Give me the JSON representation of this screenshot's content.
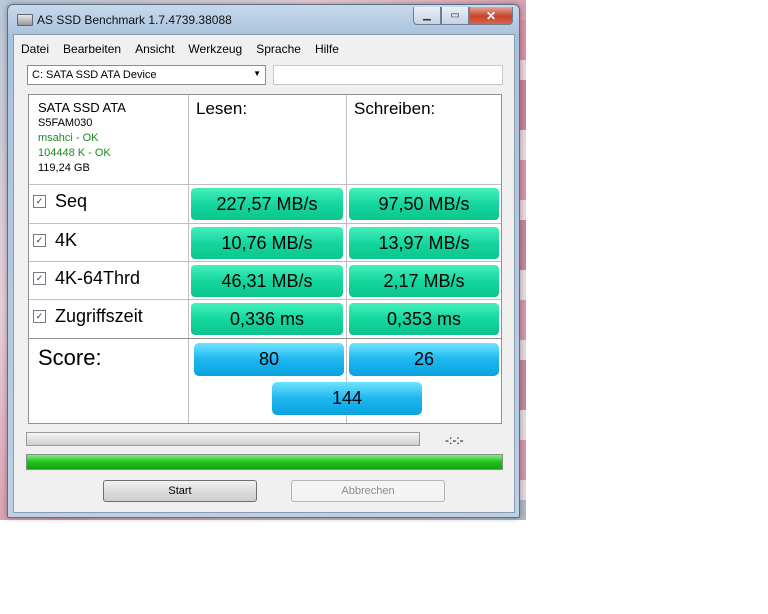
{
  "window": {
    "title": "AS SSD Benchmark 1.7.4739.38088"
  },
  "menu": [
    "Datei",
    "Bearbeiten",
    "Ansicht",
    "Werkzeug",
    "Sprache",
    "Hilfe"
  ],
  "drive": {
    "selected": "C: SATA SSD ATA Device"
  },
  "info": {
    "model": "SATA SSD ATA",
    "firmware": "S5FAM030",
    "driver_status": "msahci - OK",
    "alignment_status": "104448 K - OK",
    "capacity": "119,24 GB"
  },
  "columns": {
    "read": "Lesen:",
    "write": "Schreiben:"
  },
  "rows": [
    {
      "label": "Seq",
      "checked": true,
      "read": "227,57 MB/s",
      "write": "97,50 MB/s"
    },
    {
      "label": "4K",
      "checked": true,
      "read": "10,76 MB/s",
      "write": "13,97 MB/s"
    },
    {
      "label": "4K-64Thrd",
      "checked": true,
      "read": "46,31 MB/s",
      "write": "2,17 MB/s"
    },
    {
      "label": "Zugriffszeit",
      "checked": true,
      "read": "0,336 ms",
      "write": "0,353 ms"
    }
  ],
  "score": {
    "label": "Score:",
    "read": "80",
    "write": "26",
    "total": "144"
  },
  "progress": {
    "elapsed": "-:-:-",
    "fraction": 1.0
  },
  "buttons": {
    "start": "Start",
    "abort": "Abbrechen"
  },
  "colors": {
    "value_green": "#14d79e",
    "score_blue": "#1eb6ef",
    "progress_green": "#1fc21b"
  },
  "icons": {
    "checkbox": "✓"
  }
}
